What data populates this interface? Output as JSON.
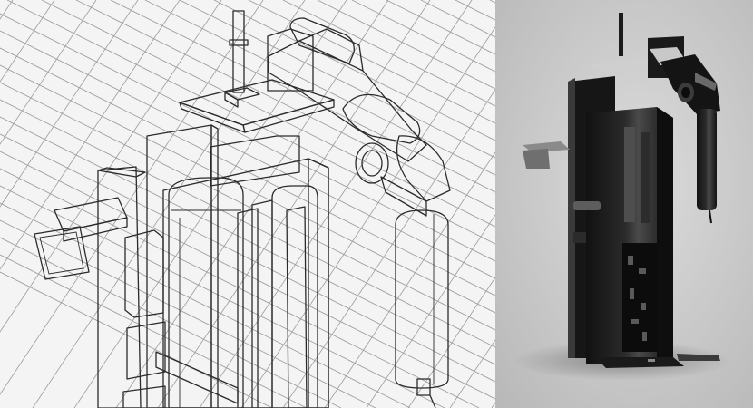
{
  "scene": {
    "left_view": "cad-shaded-with-edges",
    "right_view": "rendered-preview",
    "colors": {
      "grid_background": "#f4f4f4",
      "grid_line": "#9c9c9c",
      "model_body": "#8a8882",
      "model_edge": "#2b2b2b",
      "render_background": "#c9c9c9",
      "render_body": "#1e1e1e",
      "render_highlight": "#d9d9d9"
    },
    "icons": [
      "cad-model",
      "rendered-model"
    ]
  }
}
